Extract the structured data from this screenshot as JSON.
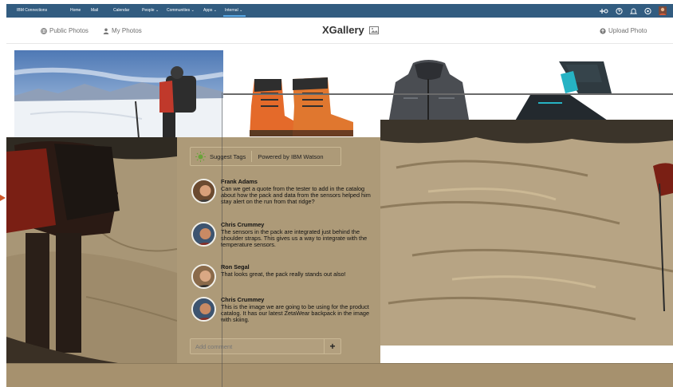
{
  "topnav": {
    "brand": "IBM Connections",
    "items": [
      "Home",
      "Mail",
      "Calendar",
      "People ⌄",
      "Communities ⌄",
      "Apps ⌄",
      "Internal ⌄"
    ],
    "icons": [
      "add-icon",
      "help-icon",
      "notifications-icon",
      "settings-icon",
      "user-avatar"
    ]
  },
  "gallery": {
    "public_photos": "Public Photos",
    "my_photos": "My Photos",
    "title": "XGallery",
    "upload": "Upload Photo"
  },
  "tags": {
    "suggest": "Suggest Tags",
    "powered": "Powered by IBM Watson"
  },
  "comments": [
    {
      "name": "Frank Adams",
      "text": "Can we get a quote from the tester to add in the catalog about how the pack and data from the sensors helped him stay alert on the run from that ridge?"
    },
    {
      "name": "Chris Crummey",
      "text": "The sensors in the pack are integrated just behind the shoulder straps. This gives us a way to integrate with the temperature sensors."
    },
    {
      "name": "Ron Segal",
      "text": "That looks great, the pack really stands out also!"
    },
    {
      "name": "Chris Crummey",
      "text": "This is the image we are going to be using for the product catalog. It has our latest ZetaWear backpack in the image with skiing."
    }
  ],
  "add_comment": {
    "placeholder": "Add comment",
    "button": "+"
  },
  "colors": {
    "nav": "#325c80",
    "overlay": "#ad9a78",
    "accent": "#d0592a"
  }
}
